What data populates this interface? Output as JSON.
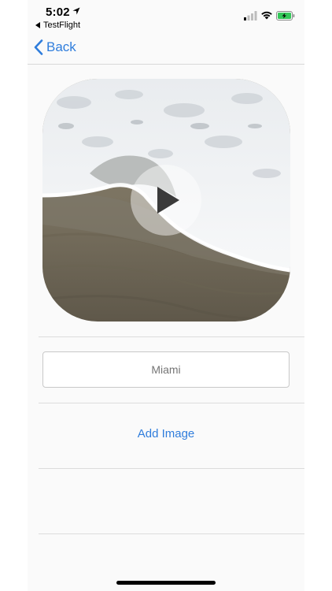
{
  "status_bar": {
    "time": "5:02",
    "back_app_label": "TestFlight"
  },
  "nav": {
    "back_label": "Back"
  },
  "media": {
    "type": "video",
    "icon": "play-icon"
  },
  "name_field": {
    "value": "",
    "placeholder": "Miami"
  },
  "actions": {
    "add_image_label": "Add Image"
  },
  "colors": {
    "accent": "#2f7ddc",
    "background": "#fafafa",
    "battery": "#34c759"
  }
}
